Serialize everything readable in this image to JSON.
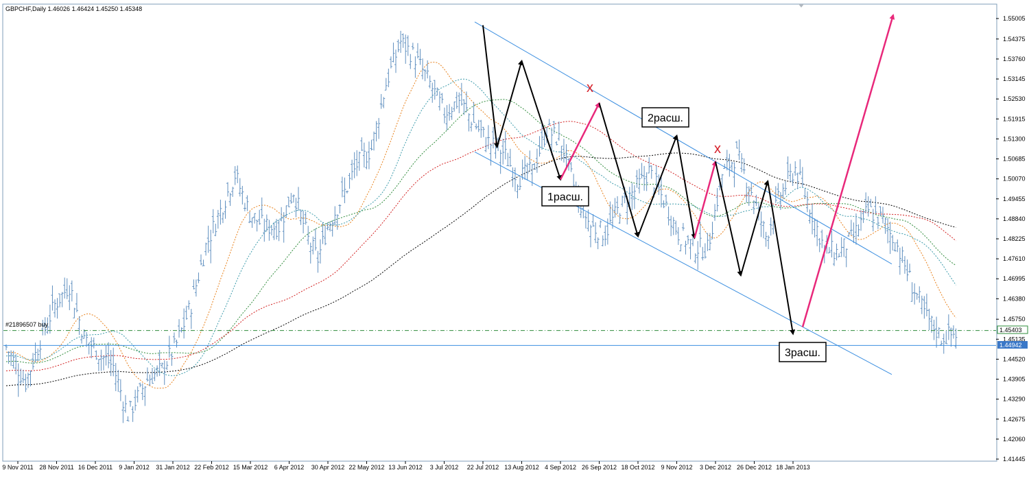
{
  "window": {
    "title": "GBPCHF,Daily",
    "ohlc": "1.46026 1.46424 1.45250 1.45348",
    "order_label": "#21896507 buy"
  },
  "price_tags": {
    "order_price": "1.45403",
    "current_price": "1.44942"
  },
  "annotations": {
    "expansion_1": "1расш.",
    "expansion_2": "2расш.",
    "expansion_3": "3расш.",
    "cross_1": "x",
    "cross_2": "x"
  },
  "colors": {
    "background": "#ffffff",
    "frame": "#7f9db9",
    "bars": "#5f8fbf",
    "channel": "#3c8fe0",
    "zigzag": "#000000",
    "correction_arrow": "#e8287a",
    "cross": "#d6202a",
    "ma_orange": "#e8801a",
    "ma_teal": "#3a9aaa",
    "ma_green": "#2e8b3a",
    "ma_red": "#d21e1e",
    "ma_black": "#000000",
    "order_line": "#2e8b3a",
    "current_tag_bg": "#3a78c8"
  },
  "chart_data": {
    "type": "line",
    "title": "GBPCHF,Daily",
    "xlabel": "",
    "ylabel": "",
    "ylim": [
      1.41445,
      1.55005
    ],
    "y_ticks": [
      "1.55005",
      "1.54375",
      "1.53760",
      "1.53145",
      "1.52530",
      "1.51915",
      "1.51300",
      "1.50685",
      "1.50070",
      "1.49455",
      "1.48840",
      "1.48225",
      "1.47610",
      "1.46995",
      "1.46380",
      "1.45750",
      "1.45135",
      "1.44520",
      "1.43905",
      "1.43290",
      "1.42675",
      "1.42060",
      "1.41445"
    ],
    "x_ticks": [
      "9 Nov 2011",
      "28 Nov 2011",
      "16 Dec 2011",
      "9 Jan 2012",
      "31 Jan 2012",
      "22 Feb 2012",
      "15 Mar 2012",
      "6 Apr 2012",
      "30 Apr 2012",
      "22 May 2012",
      "13 Jun 2012",
      "3 Jul 2012",
      "22 Jul 2012",
      "13 Aug 2012",
      "4 Sep 2012",
      "26 Sep 2012",
      "18 Oct 2012",
      "9 Nov 2012",
      "3 Dec 2012",
      "26 Dec 2012",
      "18 Jan 2013"
    ],
    "grid": false,
    "price_path": {
      "index": [
        0,
        8,
        14,
        20,
        26,
        32,
        38,
        44,
        50,
        58,
        64,
        70,
        76,
        82,
        88,
        94,
        100,
        106,
        112,
        118,
        124,
        128,
        132,
        138,
        144,
        150,
        156,
        162,
        168,
        174,
        180,
        186,
        192,
        198,
        204,
        210,
        216,
        222,
        228,
        234,
        240,
        246,
        252,
        258,
        264,
        270,
        276,
        282,
        288,
        294,
        300,
        306,
        312,
        318,
        324,
        330,
        336,
        342,
        348,
        354,
        360,
        366,
        372,
        378,
        384,
        390
      ],
      "close": [
        1.449,
        1.438,
        1.451,
        1.462,
        1.468,
        1.452,
        1.447,
        1.443,
        1.428,
        1.439,
        1.442,
        1.45,
        1.462,
        1.48,
        1.491,
        1.502,
        1.49,
        1.486,
        1.486,
        1.497,
        1.482,
        1.476,
        1.486,
        1.495,
        1.505,
        1.51,
        1.53,
        1.543,
        1.538,
        1.53,
        1.521,
        1.525,
        1.518,
        1.512,
        1.509,
        1.501,
        1.503,
        1.516,
        1.512,
        1.496,
        1.486,
        1.484,
        1.492,
        1.497,
        1.503,
        1.494,
        1.484,
        1.48,
        1.479,
        1.502,
        1.508,
        1.497,
        1.483,
        1.496,
        1.504,
        1.492,
        1.479,
        1.478,
        1.483,
        1.491,
        1.488,
        1.48,
        1.468,
        1.458,
        1.452,
        1.453
      ]
    },
    "channel": {
      "upper": {
        "from": [
          "22 Jul 2012",
          1.549
        ],
        "to": [
          "18 Jan 2013+",
          1.4745
        ]
      },
      "lower": {
        "from": [
          "22 Jul 2012",
          1.509
        ],
        "to": [
          "18 Jan 2013+",
          1.4405
        ]
      }
    },
    "order_level": 1.45403,
    "current_level": 1.44942,
    "zigzag": [
      [
        "22 Jul 2012",
        1.548
      ],
      [
        "30 Jul 2012",
        1.5105
      ],
      [
        "13 Aug 2012",
        1.537
      ],
      [
        "4 Sep 2012",
        1.5005
      ],
      [
        "26 Sep 2012",
        1.524
      ],
      [
        "18 Oct 2012",
        1.483
      ],
      [
        "9 Nov 2012",
        1.514
      ],
      [
        "20 Nov 2012",
        1.4825
      ],
      [
        "3 Dec 2012",
        1.506
      ],
      [
        "18 Dec 2012",
        1.471
      ],
      [
        "3 Jan 2013",
        1.5
      ],
      [
        "18 Jan 2013",
        1.453
      ]
    ]
  }
}
